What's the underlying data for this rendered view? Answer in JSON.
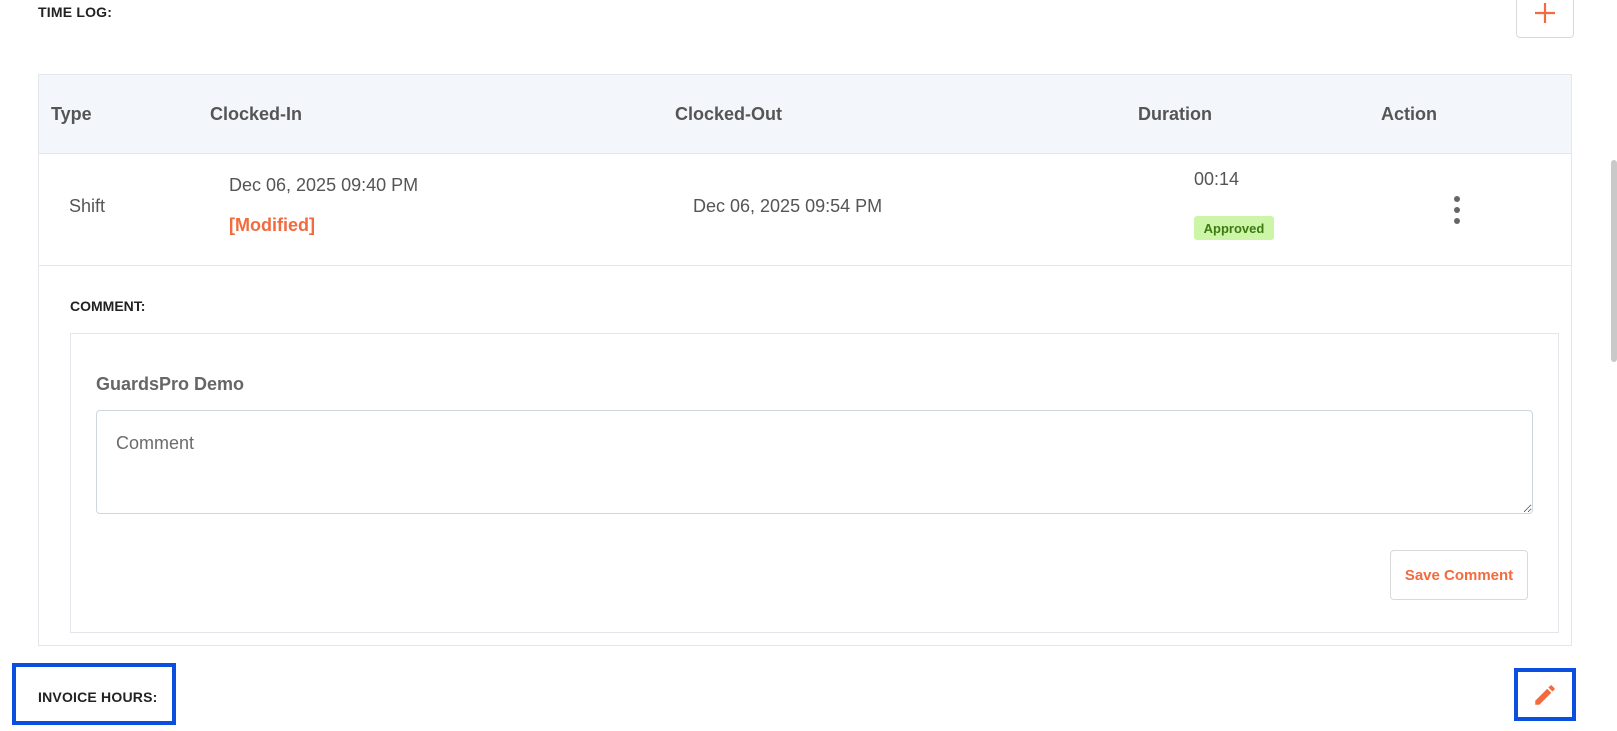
{
  "time_log": {
    "title": "TIME LOG:",
    "add_icon": "plus-icon"
  },
  "table": {
    "headers": [
      "Type",
      "Clocked-In",
      "Clocked-Out",
      "Duration",
      "Action"
    ],
    "rows": [
      {
        "type": "Shift",
        "clocked_in": "Dec 06, 2025 09:40 PM",
        "modified_label": "[Modified]",
        "clocked_out": "Dec 06, 2025 09:54 PM",
        "duration": "00:14",
        "status": "Approved",
        "action_icon": "more-vertical-icon"
      }
    ]
  },
  "comment": {
    "label": "COMMENT:",
    "author": "GuardsPro Demo",
    "placeholder": "Comment",
    "value": "",
    "save_label": "Save Comment"
  },
  "invoice_hours": {
    "title": "INVOICE HOURS:",
    "edit_icon": "pencil-icon"
  },
  "colors": {
    "accent": "#f26a3d",
    "approved_bg": "#ccf5a8",
    "approved_text": "#3d7a12",
    "header_bg": "#f3f7fc",
    "highlight": "#0b4fe0"
  }
}
